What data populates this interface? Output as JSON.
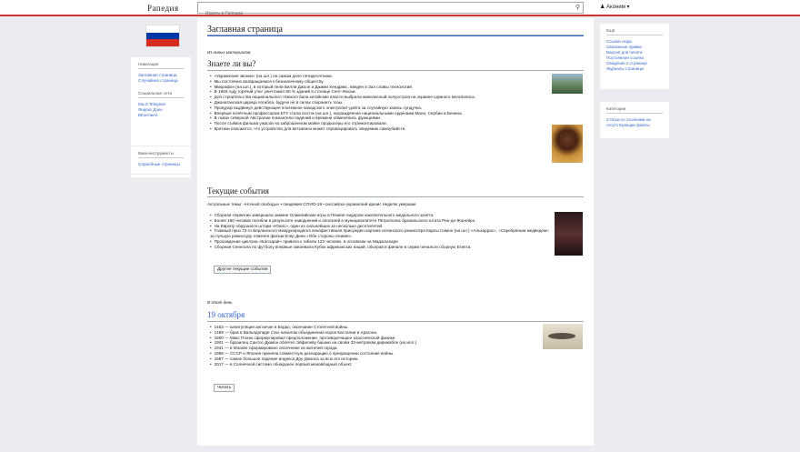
{
  "header": {
    "logo": "Рапедия",
    "search_placeholder": "Искать в Рапедии",
    "user": "Аконим"
  },
  "flag_colors": [
    "#ffffff",
    "#0039a6",
    "#d52b1e"
  ],
  "sidebar_left": {
    "nav_title": "Навигация",
    "nav_items": [
      "Заглавная страница",
      "Случайная страница"
    ],
    "social_title": "Социальные сети",
    "social_items": [
      "Мы в Telegram",
      "Яндекс.Дзен",
      "ВКонтакте"
    ],
    "tools_title": "Вики-инструменты",
    "tools_items": [
      "Служебные страницы"
    ]
  },
  "sidebar_right": {
    "title1": "Ещё",
    "items1": [
      "Ссылки сюда",
      "Связанные правки",
      "Версия для печати",
      "Постоянная ссылка",
      "Сведения о странице",
      "Журналы страницы"
    ],
    "title2": "Категории",
    "items2": [
      "Статьи со ссылками на отсутствующие файлы"
    ]
  },
  "main": {
    "title": "Заглавная страница",
    "new_materials": "Из новых материалов",
    "dyk_title": "Знаете ли вы?",
    "dyk": [
      "«Украинские звонки» (на шл.) на самом деле пятидесятники.",
      "Мы постоянно возвращаемся к безналичному обществу.",
      "Микрофон (на шл.), в который пели Билли Джоэл и Джими Хендрикс, введён в Зал славы технологий.",
      "В 1948 году горячий утюг уничтожил 80 % зданий в столице Сент-Люсии.",
      "Для строительства национального тяжного бала китайские власти выбрали живописный полуостров на окраине шумного мегаполиса.",
      "Джонатанская царица погибла, будучи не в силах сохранить тезы.",
      "Прокурор выдвинул действующее платежное канадского электропит-дэйта за случайную запись сундучка.",
      "Впервые почётным профессором ЕГУ стала поэтэк (на шл.), награждённая национальными орденами Мали, Сербии и Бенина.",
      "В львах северной Австралии показатели падений и времени обменялись функциями.",
      "После съёмок фильма ужасов на заброшенном маяке продюсеры его отремонтировали.",
      "Критики опасаются, что устройство для ветзаписи может спровоцировать эпидемию самоубийств."
    ],
    "news_title": "Текущие события",
    "news_topics": "Актуальные темы: «Ночной свободы» • пандемия COVID-19 • российско-украинский кризис Неделю умершие",
    "news": [
      "Сборная Норвегии завершила зимние Олимпийские игры в Пекине лидером накопительного медального зачёта.",
      "Более 150 человек погибли в результате наводнений и оползней в муниципалитете Петрополис бразильского штата Рио-де-Жанейро.",
      "На Европу обрушился шторм «Юнис», один из сильнейших за несколько десятилетий.",
      "Главный приз 72-го Берлинского международного кинофестиваля присуждён картине испанского режиссёра Карлы Симон (на шл.) «Алькаррас», «Серебряным медведем» за лучшую режиссуру отмечен фильм Клер Дени «Обе стороны лезвия».",
      "Прохождение циклона «Батсирай» привело к гибели 123 человек, в основном на Мадагаскаре.",
      "Сборная Сенегала по футболу впервые завоевала Кубок африканских наций, обыграв в финале в серии пенальти сборную Египта."
    ],
    "news_button": "Другие текущие события",
    "onthisday_small": "В этот день",
    "date": "19 октября",
    "events": [
      "1453 — капитуляция англичан в Бордо, окончание Столетней войны.",
      "1469 — брак в Вальядолиде стал началом объединения корон Кастилии и Арагона.",
      "1900 — Макс Планк сформулировал предположение, противоречащее классической физике.",
      "1901 — бразилец Сантос-Дюмон облетел Эйфелеву башню на своём 33-метровом дирижабле (на илл.).",
      "1941 — в Москве сформировано ополчение из жителей города.",
      "1956 — СССР и Япония приняли совместную декларацию о прекращении состояния войны.",
      "1987 — самое большое падение индекса Доу Джонса за всю его историю.",
      "2017 — в Солнечной системе обнаружен первый межзвёздный объект."
    ],
    "read_button": "Читать"
  }
}
